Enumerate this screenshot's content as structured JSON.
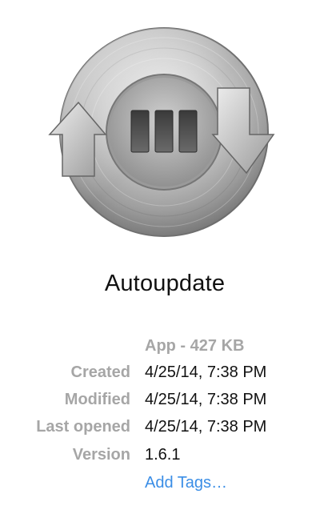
{
  "app": {
    "name": "Autoupdate",
    "icon": "autoupdate-icon",
    "kind_and_size": "App - 427 KB"
  },
  "info": [
    {
      "label": "Created",
      "value": "4/25/14, 7:38 PM"
    },
    {
      "label": "Modified",
      "value": "4/25/14, 7:38 PM"
    },
    {
      "label": "Last opened",
      "value": "4/25/14, 7:38 PM"
    },
    {
      "label": "Version",
      "value": "1.6.1"
    }
  ],
  "tags": {
    "add_label": "Add Tags…"
  },
  "colors": {
    "label_gray": "#a6a6a6",
    "value_text": "#111111",
    "link_blue": "#3b8ee6"
  }
}
